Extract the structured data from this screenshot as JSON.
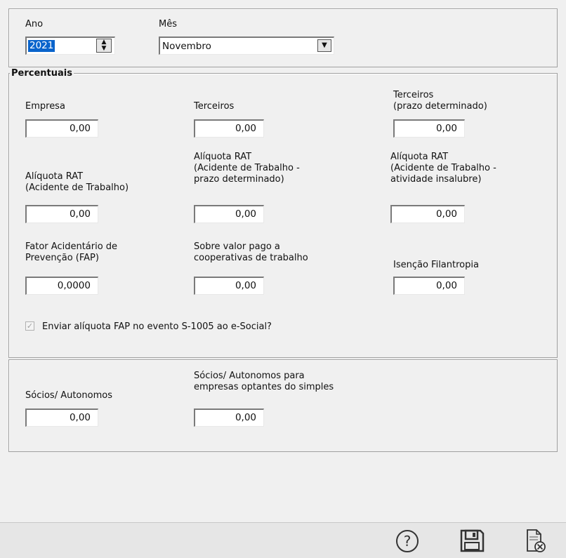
{
  "period": {
    "year_label": "Ano",
    "year_value": "2021",
    "month_label": "Mês",
    "month_value": "Novembro"
  },
  "percentuais": {
    "title": "Percentuais",
    "empresa": {
      "label": "Empresa",
      "value": "0,00"
    },
    "terceiros": {
      "label": "Terceiros",
      "value": "0,00"
    },
    "terceiros_prazo": {
      "label": "Terceiros\n(prazo determinado)",
      "value": "0,00"
    },
    "rat": {
      "label": "Alíquota RAT\n(Acidente de Trabalho)",
      "value": "0,00"
    },
    "rat_prazo": {
      "label": "Alíquota RAT\n(Acidente de Trabalho -\nprazo determinado)",
      "value": "0,00"
    },
    "rat_insalubre": {
      "label": "Alíquota RAT\n(Acidente de Trabalho -\natividade insalubre)",
      "value": "0,00"
    },
    "fap": {
      "label": "Fator Acidentário de\nPrevenção (FAP)",
      "value": "0,0000"
    },
    "cooperativas": {
      "label": "Sobre valor pago a\ncooperativas de trabalho",
      "value": "0,00"
    },
    "filantropia": {
      "label": "Isenção Filantropia",
      "value": "0,00"
    },
    "fap_checkbox": {
      "label": "Enviar alíquota FAP no evento S-1005 ao e-Social?",
      "checked": true,
      "disabled": true
    }
  },
  "socios": {
    "autonomos": {
      "label": "Sócios/ Autonomos",
      "value": "0,00"
    },
    "simples": {
      "label": "Sócios/ Autonomos para\nempresas optantes do simples",
      "value": "0,00"
    }
  },
  "toolbar": {
    "help_icon": "question-circle-icon",
    "save_icon": "floppy-disk-icon",
    "cancel_icon": "document-cancel-icon"
  },
  "colors": {
    "selection": "#0a64cc",
    "background": "#f0f0f0"
  }
}
